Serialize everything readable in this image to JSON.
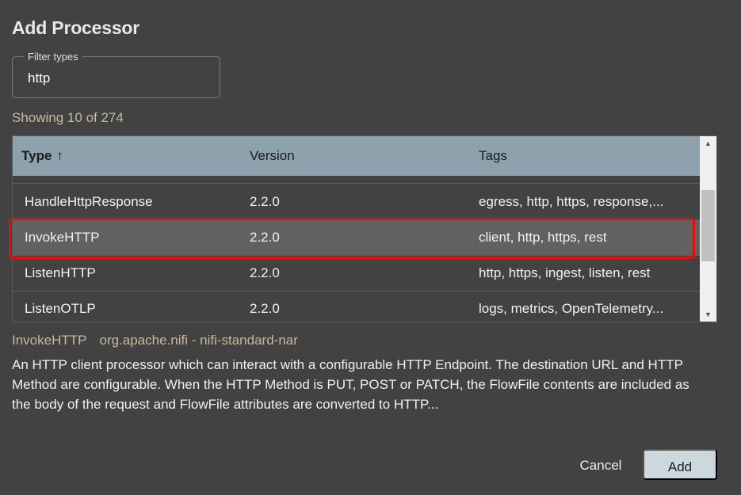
{
  "dialog": {
    "title": "Add Processor"
  },
  "filter": {
    "label": "Filter types",
    "value": "http"
  },
  "showing": "Showing 10 of 274",
  "table": {
    "headers": {
      "type": "Type",
      "sort_indicator": "↑",
      "version": "Version",
      "tags": "Tags"
    },
    "rows": [
      {
        "type": "HandleHttpResponse",
        "version": "2.2.0",
        "tags": "egress, http, https, response,...",
        "selected": false
      },
      {
        "type": "InvokeHTTP",
        "version": "2.2.0",
        "tags": "client, http, https, rest",
        "selected": true
      },
      {
        "type": "ListenHTTP",
        "version": "2.2.0",
        "tags": "http, https, ingest, listen, rest",
        "selected": false
      },
      {
        "type": "ListenOTLP",
        "version": "2.2.0",
        "tags": "logs, metrics, OpenTelemetry...",
        "selected": false
      }
    ]
  },
  "details": {
    "name": "InvokeHTTP",
    "bundle": "org.apache.nifi - nifi-standard-nar",
    "description": "An HTTP client processor which can interact with a configurable HTTP Endpoint. The destination URL and HTTP Method are configurable. When the HTTP Method is PUT, POST or PATCH, the FlowFile contents are included as the body of the request and FlowFile attributes are converted to HTTP..."
  },
  "buttons": {
    "cancel": "Cancel",
    "add": "Add"
  },
  "colors": {
    "background": "#424242",
    "header": "#8da2ad",
    "selected_row": "#616161",
    "highlight": "#e01010",
    "add_button": "#ccd7de"
  }
}
